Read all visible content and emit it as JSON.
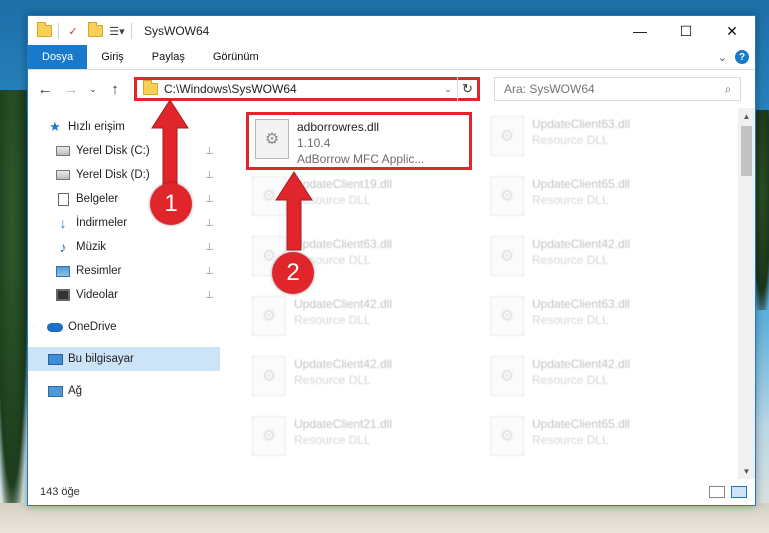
{
  "window": {
    "title": "SysWOW64",
    "minimize_glyph": "—",
    "maximize_glyph": "☐",
    "close_glyph": "✕"
  },
  "ribbon": {
    "tabs": [
      "Dosya",
      "Giriş",
      "Paylaş",
      "Görünüm"
    ],
    "active_tab": "Dosya",
    "expand_glyph": "⌄",
    "help_glyph": "?"
  },
  "navigation": {
    "back": "←",
    "forward": "→",
    "recent": "⌄",
    "up": "↑",
    "address": "C:\\Windows\\SysWOW64",
    "address_drop": "⌄",
    "refresh": "↻",
    "search_placeholder": "Ara: SysWOW64",
    "search_icon": "⌕"
  },
  "sidebar": {
    "quick_access": "Hızlı erişim",
    "items": [
      {
        "label": "Yerel Disk (C:)",
        "icon": "disk-icon"
      },
      {
        "label": "Yerel Disk (D:)",
        "icon": "disk-icon"
      },
      {
        "label": "Belgeler",
        "icon": "documents-icon"
      },
      {
        "label": "İndirmeler",
        "icon": "downloads-icon"
      },
      {
        "label": "Müzik",
        "icon": "music-icon"
      },
      {
        "label": "Resimler",
        "icon": "pictures-icon"
      },
      {
        "label": "Videolar",
        "icon": "videos-icon"
      }
    ],
    "onedrive": "OneDrive",
    "this_pc": "Bu bilgisayar",
    "network": "Ağ",
    "pin_glyph": "📌"
  },
  "files": {
    "highlighted": {
      "name": "adborrowres.dll",
      "version": "1.10.4",
      "description": "AdBorrow MFC Applic..."
    },
    "left_column": [
      {
        "name": "UpdateClient19.dll",
        "desc": "Resource DLL"
      },
      {
        "name": "UpdateClient63.dll",
        "desc": "Resource DLL"
      },
      {
        "name": "UpdateClient42.dll",
        "desc": "Resource DLL"
      },
      {
        "name": "UpdateClient42.dll",
        "desc": "Resource DLL"
      },
      {
        "name": "UpdateClient21.dll",
        "desc": "Resource DLL"
      }
    ],
    "right_column": [
      {
        "name": "UpdateClient63.dll",
        "desc": "Resource DLL"
      },
      {
        "name": "UpdateClient65.dll",
        "desc": "Resource DLL"
      },
      {
        "name": "UpdateClient42.dll",
        "desc": "Resource DLL"
      },
      {
        "name": "UpdateClient63.dll",
        "desc": "Resource DLL"
      },
      {
        "name": "UpdateClient42.dll",
        "desc": "Resource DLL"
      },
      {
        "name": "UpdateClient65.dll",
        "desc": "Resource DLL"
      }
    ]
  },
  "status": {
    "item_count": "143 öğe"
  },
  "annotations": {
    "step1": "1",
    "step2": "2",
    "color": "#e0262b"
  }
}
